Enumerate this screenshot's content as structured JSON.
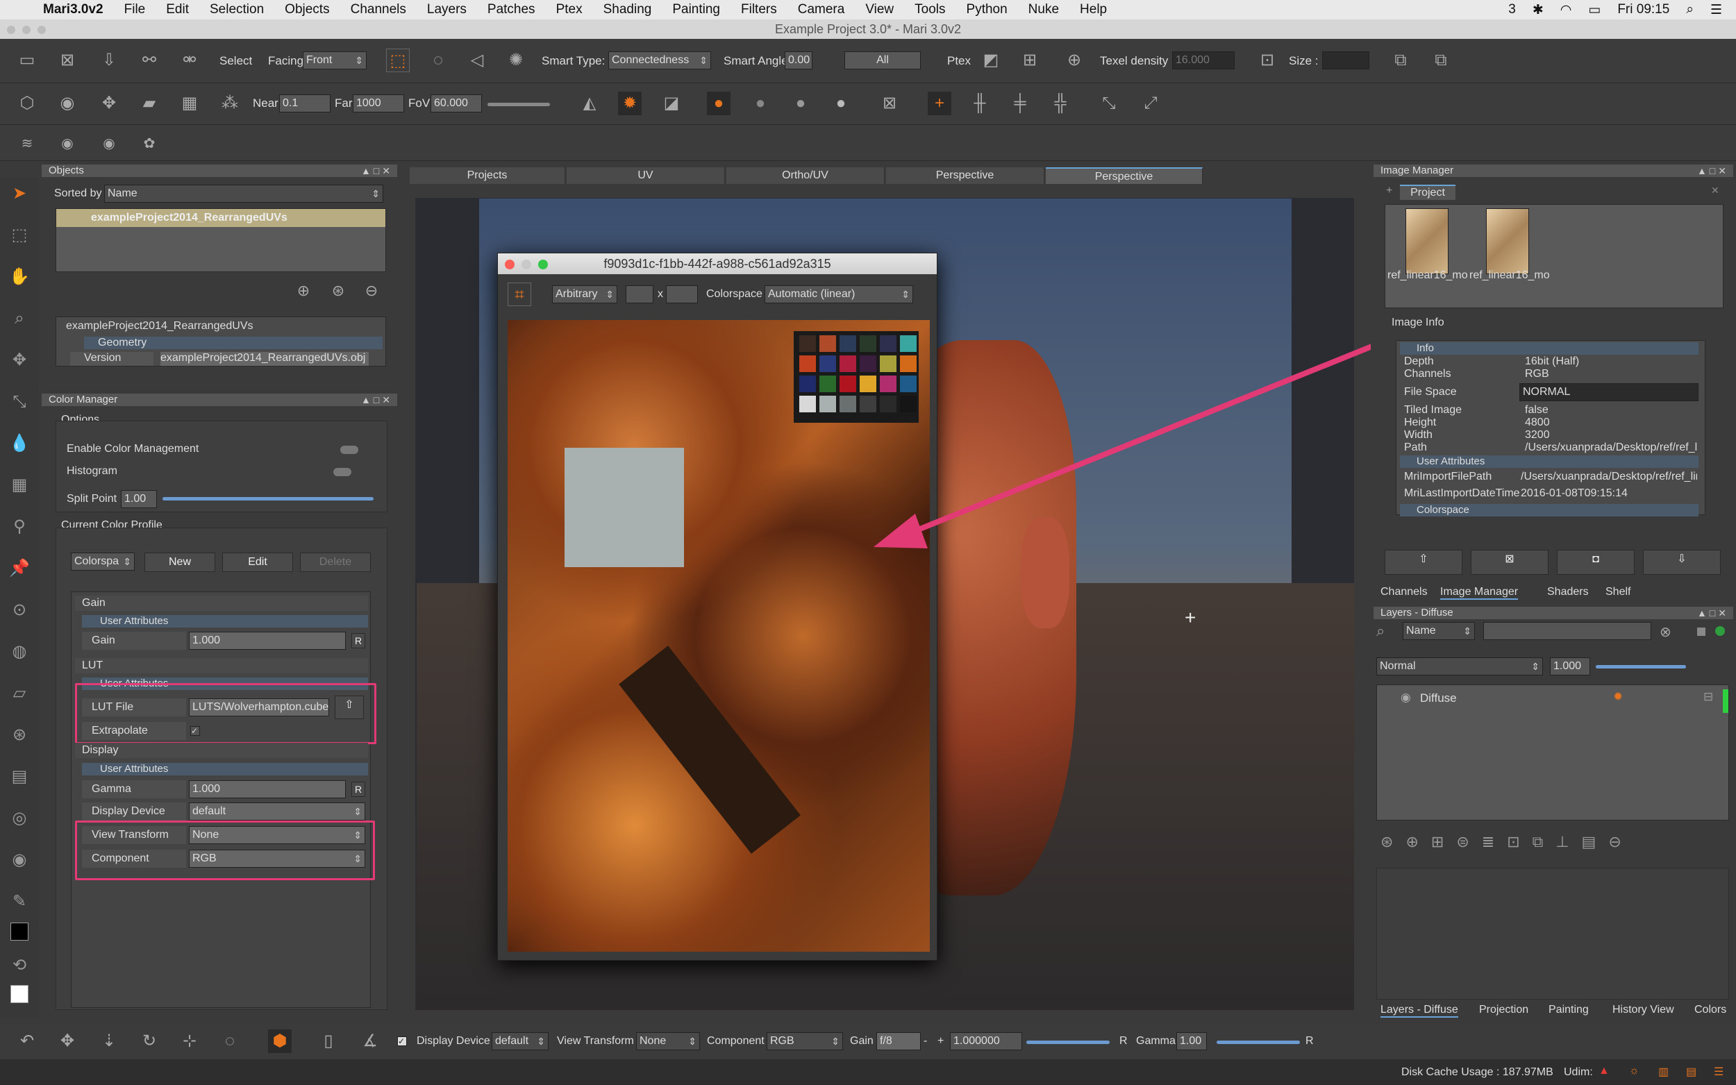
{
  "menubar": {
    "app_name": "Mari3.0v2",
    "items": [
      "File",
      "Edit",
      "Selection",
      "Objects",
      "Channels",
      "Layers",
      "Patches",
      "Ptex",
      "Shading",
      "Painting",
      "Filters",
      "Camera",
      "View",
      "Tools",
      "Python",
      "Nuke",
      "Help"
    ],
    "status_count": "3",
    "datetime": "Fri 09:15"
  },
  "window": {
    "title": "Example Project 3.0* - Mari 3.0v2"
  },
  "toolbar1": {
    "select_label": "Select",
    "facing_label": "Facing",
    "facing_value": "Front",
    "smart_type_label": "Smart Type:",
    "smart_type_value": "Connectedness",
    "smart_angle_label": "Smart Angle",
    "smart_angle_value": "0.00",
    "all_label": "All",
    "ptex_label": "Ptex",
    "texel_density_label": "Texel density :",
    "texel_density_value": "16.000",
    "size_label": "Size :"
  },
  "toolbar2": {
    "near_label": "Near",
    "near_value": "0.1",
    "far_label": "Far",
    "far_value": "1000",
    "fov_label": "FoV",
    "fov_value": "60.000"
  },
  "objects_panel": {
    "title": "Objects",
    "sorted_by_label": "Sorted by",
    "sorted_by_value": "Name",
    "object_name": "exampleProject2014_RearrangedUVs",
    "tree_root": "exampleProject2014_RearrangedUVs",
    "geometry_label": "Geometry",
    "version_label": "Version",
    "version_value": "exampleProject2014_RearrangedUVs.obj"
  },
  "color_manager": {
    "title": "Color Manager",
    "options_label": "Options",
    "enable_label": "Enable Color Management",
    "histogram_label": "Histogram",
    "split_point_label": "Split Point",
    "split_point_value": "1.00",
    "profile_label": "Current Color Profile",
    "colorspace_combo": "Colorspa",
    "new_label": "New",
    "edit_label": "Edit",
    "delete_label": "Delete",
    "gain_section": "Gain",
    "user_attributes": "User Attributes",
    "gain_label": "Gain",
    "gain_value": "1.000",
    "r_label": "R",
    "lut_section": "LUT",
    "lut_file_label": "LUT File",
    "lut_file_value": "LUTS/Wolverhampton.cube",
    "extrapolate_label": "Extrapolate",
    "display_section": "Display",
    "gamma_label": "Gamma",
    "gamma_value": "1.000",
    "display_device_label": "Display Device",
    "display_device_value": "default",
    "view_transform_label": "View Transform",
    "view_transform_value": "None",
    "component_label": "Component",
    "component_value": "RGB"
  },
  "viewport": {
    "tabs": [
      "Projects",
      "UV",
      "Ortho/UV",
      "Perspective",
      "Perspective"
    ]
  },
  "image_window": {
    "title": "f9093d1c-f1bb-442f-a988-c561ad92a315",
    "crop_mode": "Arbitrary",
    "x_label": "x",
    "colorspace_label": "Colorspace",
    "colorspace_value": "Automatic (linear)"
  },
  "image_manager": {
    "title": "Image Manager",
    "tab_project": "Project",
    "thumb1_label": "ref_linear16_mo",
    "thumb2_label": "ref_linear16_mo",
    "image_info_label": "Image Info",
    "info_section": "Info",
    "rows": [
      {
        "k": "Depth",
        "v": "16bit (Half)"
      },
      {
        "k": "Channels",
        "v": "RGB"
      },
      {
        "k": "File Space",
        "v": "NORMAL"
      },
      {
        "k": "Tiled Image",
        "v": "false"
      },
      {
        "k": "Height",
        "v": "4800"
      },
      {
        "k": "Width",
        "v": "3200"
      },
      {
        "k": "Path",
        "v": "/Users/xuanprada/Desktop/ref/ref_li"
      }
    ],
    "user_attributes": "User Attributes",
    "ua_rows": [
      {
        "k": "MriImportFilePath",
        "v": "/Users/xuanprada/Desktop/ref/ref_lin"
      },
      {
        "k": "MriLastImportDateTime",
        "v": "2016-01-08T09:15:14"
      }
    ],
    "colorspace_section": "Colorspace"
  },
  "right_tabs": [
    "Channels",
    "Image Manager",
    "Shaders",
    "Shelf"
  ],
  "layers_panel": {
    "title": "Layers - Diffuse",
    "filter_by": "Name",
    "blend_mode": "Normal",
    "opacity": "1.000",
    "layer_name": "Diffuse"
  },
  "bottom_right_tabs": [
    "Layers - Diffuse",
    "Projection",
    "Painting",
    "History View",
    "Colors"
  ],
  "bottom_bar": {
    "display_device_label": "Display Device",
    "display_device_value": "default",
    "view_transform_label": "View Transform",
    "view_transform_value": "None",
    "component_label": "Component",
    "component_value": "RGB",
    "gain_label": "Gain",
    "gain_fstop": "f/8",
    "gain_value": "1.000000",
    "r_label": "R",
    "gamma_label": "Gamma",
    "gamma_value": "1.00"
  },
  "status": {
    "disk_cache": "Disk Cache Usage : 187.97MB",
    "udim_label": "Udim:"
  },
  "colors": {
    "annotation": "#e23a75",
    "accent_orange": "#e8741e",
    "selection_blue": "#6aa3d8"
  }
}
